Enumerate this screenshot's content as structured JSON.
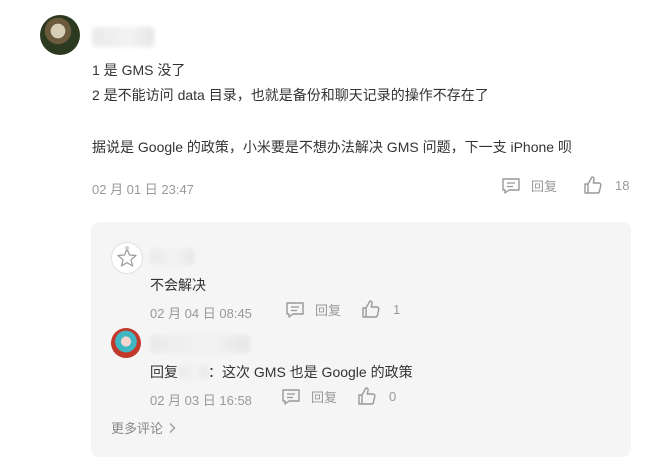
{
  "comment": {
    "lines": [
      "1 是 GMS 没了",
      "2 是不能访问 data 目录，也就是备份和聊天记录的操作不存在了",
      "据说是 Google 的政策，小米要是不想办法解决 GMS 问题，下一支 iPhone 呗"
    ],
    "timestamp": "02 月 01 日 23:47",
    "reply_label": "回复",
    "like_count": "18"
  },
  "replies": [
    {
      "text": "不会解决",
      "timestamp": "02 月 04 日 08:45",
      "reply_label": "回复",
      "like_count": "1"
    },
    {
      "reply_prefix": "回复",
      "reply_text": "：这次 GMS 也是 Google 的政策",
      "timestamp": "02 月 03 日 16:58",
      "reply_label": "回复",
      "like_count": "0"
    }
  ],
  "more_comments": "更多评论",
  "icons": {
    "reply": "reply-icon",
    "like": "thumbs-up-icon",
    "more": "chevron-right-icon"
  }
}
